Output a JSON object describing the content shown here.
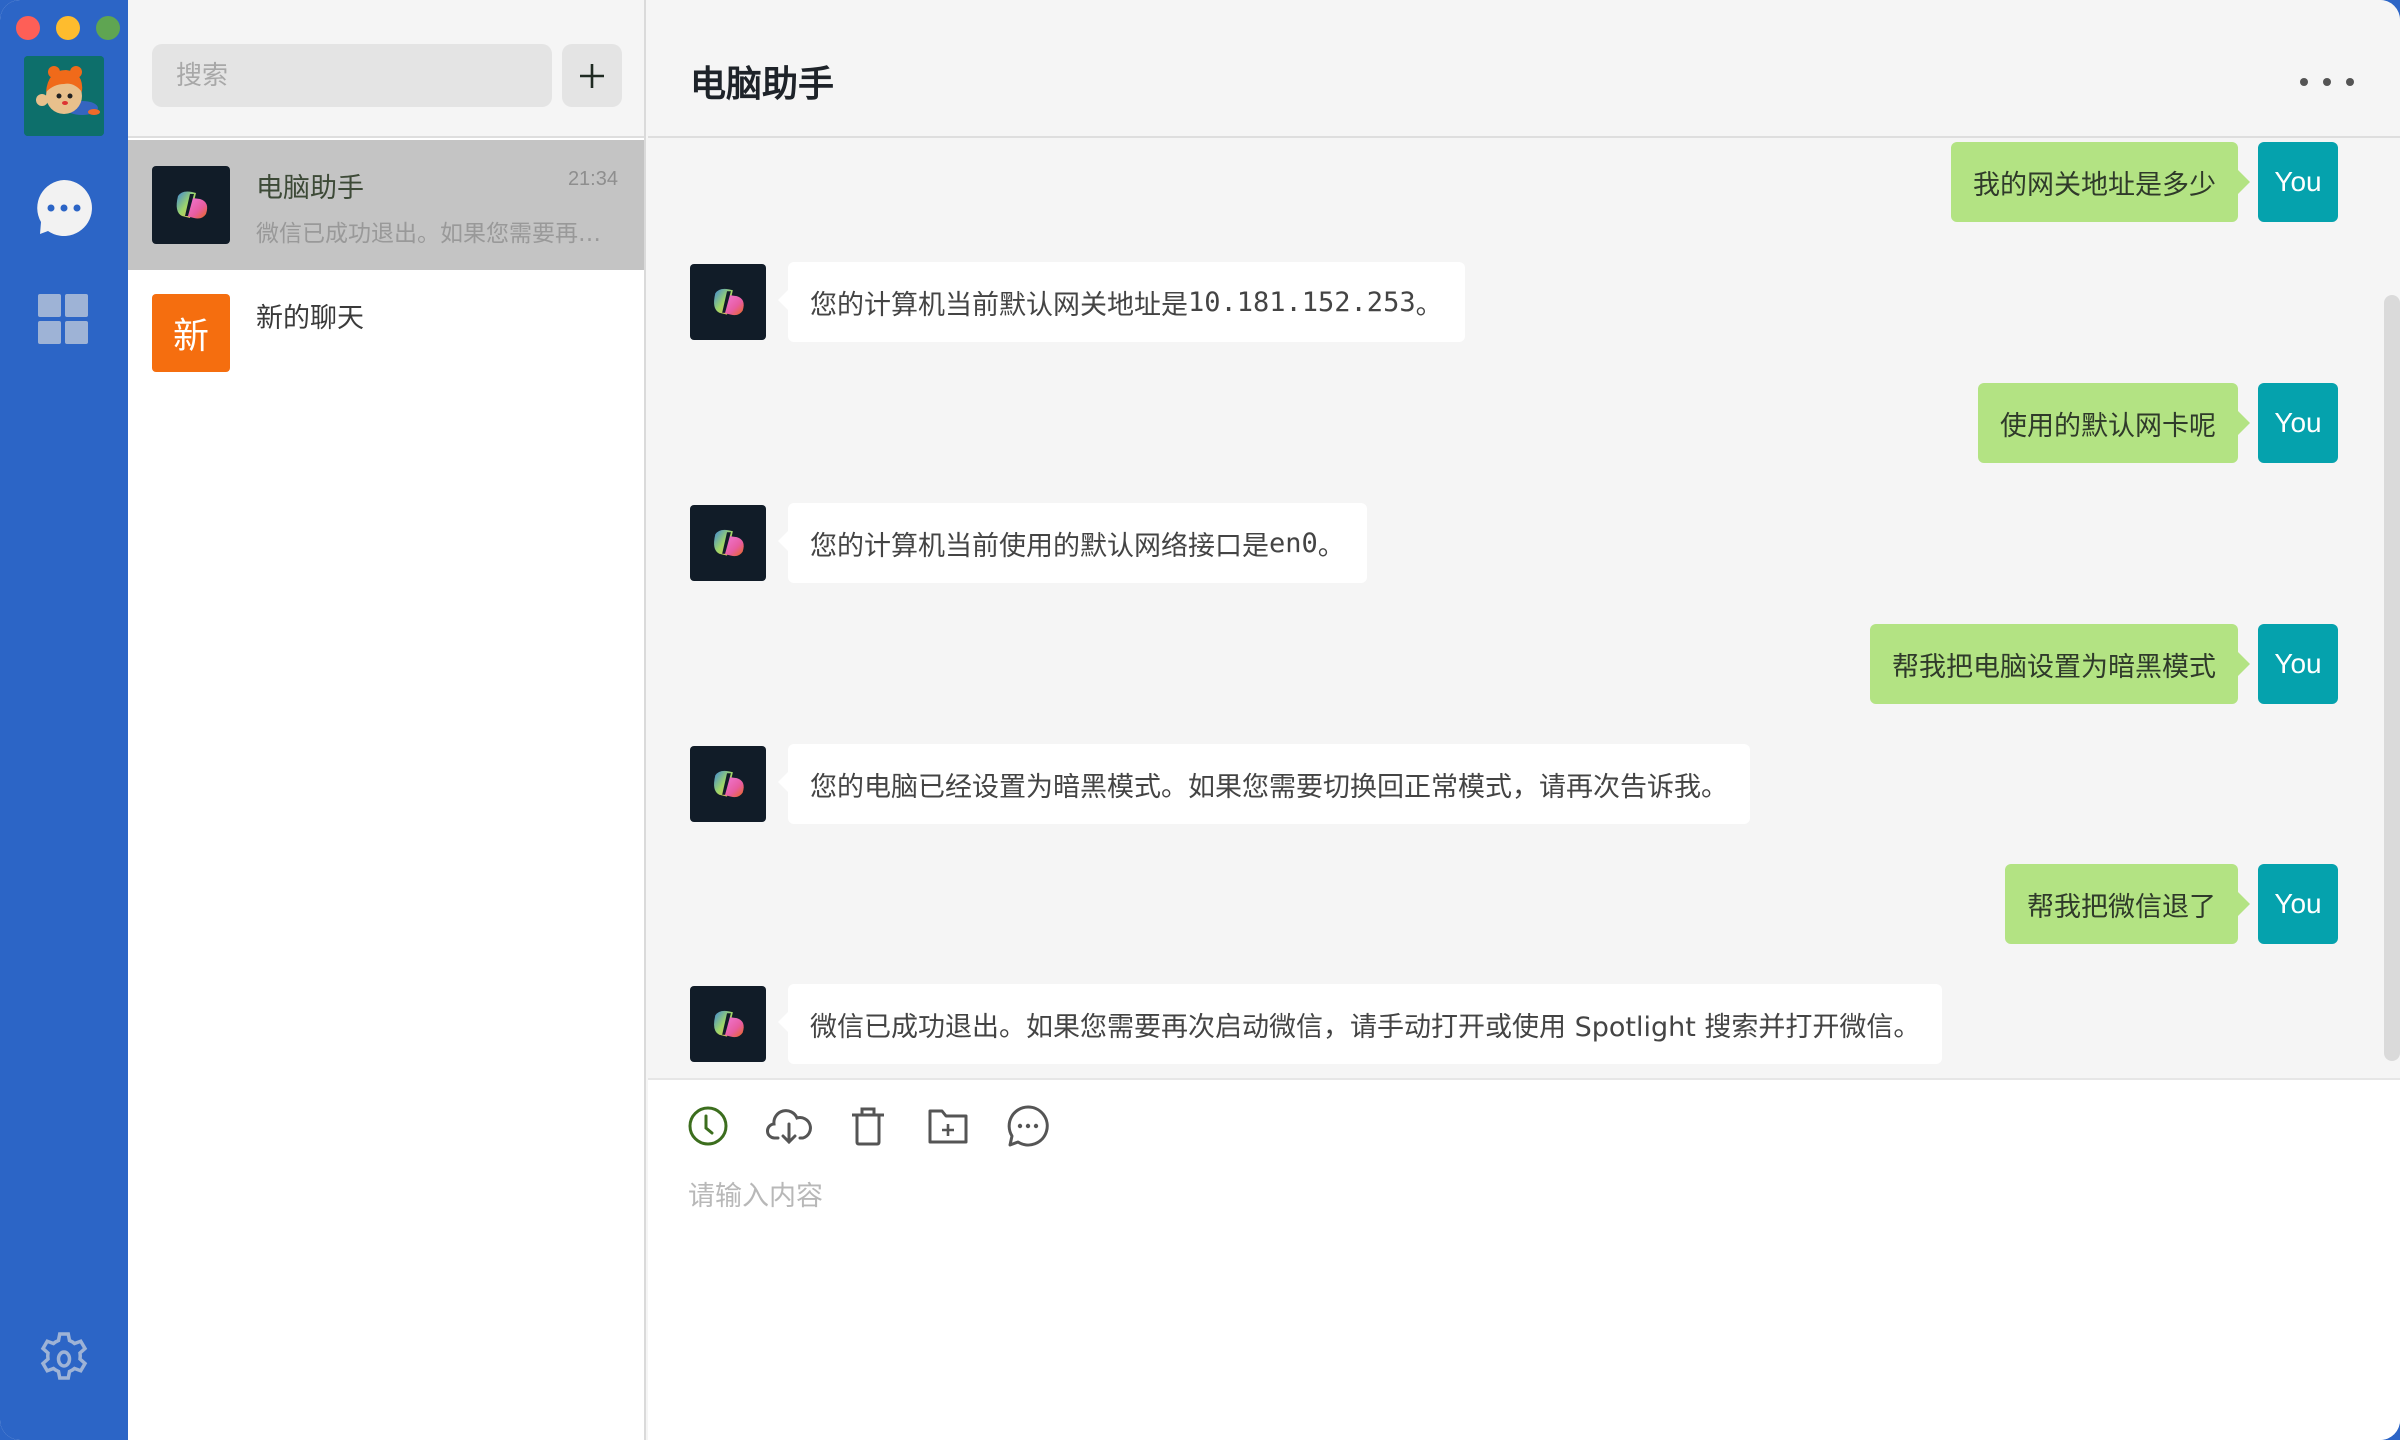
{
  "window": {
    "traffic_lights": [
      "close",
      "minimize",
      "maximize"
    ]
  },
  "nav": {
    "items": [
      {
        "name": "profile-avatar",
        "icon": "bear-pilot-avatar"
      },
      {
        "name": "chats",
        "icon": "chat-bubble-icon",
        "active": true
      },
      {
        "name": "apps",
        "icon": "grid-icon"
      },
      {
        "name": "settings",
        "icon": "gear-icon"
      }
    ]
  },
  "chat_list": {
    "search_placeholder": "搜索",
    "add_label": "+",
    "conversations": [
      {
        "name": "电脑助手",
        "time": "21:34",
        "preview": "微信已成功退出。如果您需要再次启动微信，请手动打开或使用 Spotlight 搜索并打开微信。",
        "avatar": "copilot-logo",
        "active": true
      },
      {
        "name": "新的聊天",
        "time": "",
        "preview": "",
        "avatar_text": "新",
        "active": false
      }
    ]
  },
  "header": {
    "title": "电脑助手",
    "more_icon": "more-horizontal-icon"
  },
  "messages": [
    {
      "role": "user",
      "text": "我的网关地址是多少",
      "avatar_label": "You"
    },
    {
      "role": "bot",
      "text_prefix": "您的计算机当前默认网关地址是 ",
      "code": "10.181.152.253",
      "text_suffix": "。"
    },
    {
      "role": "user",
      "text": "使用的默认网卡呢",
      "avatar_label": "You"
    },
    {
      "role": "bot",
      "text_prefix": "您的计算机当前使用的默认网络接口是 ",
      "code": "en0",
      "text_suffix": "。"
    },
    {
      "role": "user",
      "text": "帮我把电脑设置为暗黑模式",
      "avatar_label": "You"
    },
    {
      "role": "bot",
      "text": "您的电脑已经设置为暗黑模式。如果您需要切换回正常模式，请再次告诉我。"
    },
    {
      "role": "user",
      "text": "帮我把微信退了",
      "avatar_label": "You"
    },
    {
      "role": "bot",
      "text": "微信已成功退出。如果您需要再次启动微信，请手动打开或使用 Spotlight 搜索并打开微信。"
    }
  ],
  "composer": {
    "tools": [
      "history-clock-icon",
      "cloud-download-icon",
      "trash-icon",
      "folder-add-icon",
      "chat-more-icon"
    ],
    "placeholder": "请输入内容",
    "value": ""
  },
  "colors": {
    "nav_bg": "#2c65c6",
    "user_bubble": "#b3e383",
    "user_avatar": "#05a2ad",
    "bot_avatar_bg": "#111c28",
    "new_chat_avatar": "#f56e0f",
    "active_row": "#c4c4c4",
    "history_icon": "#3c6e1e"
  }
}
